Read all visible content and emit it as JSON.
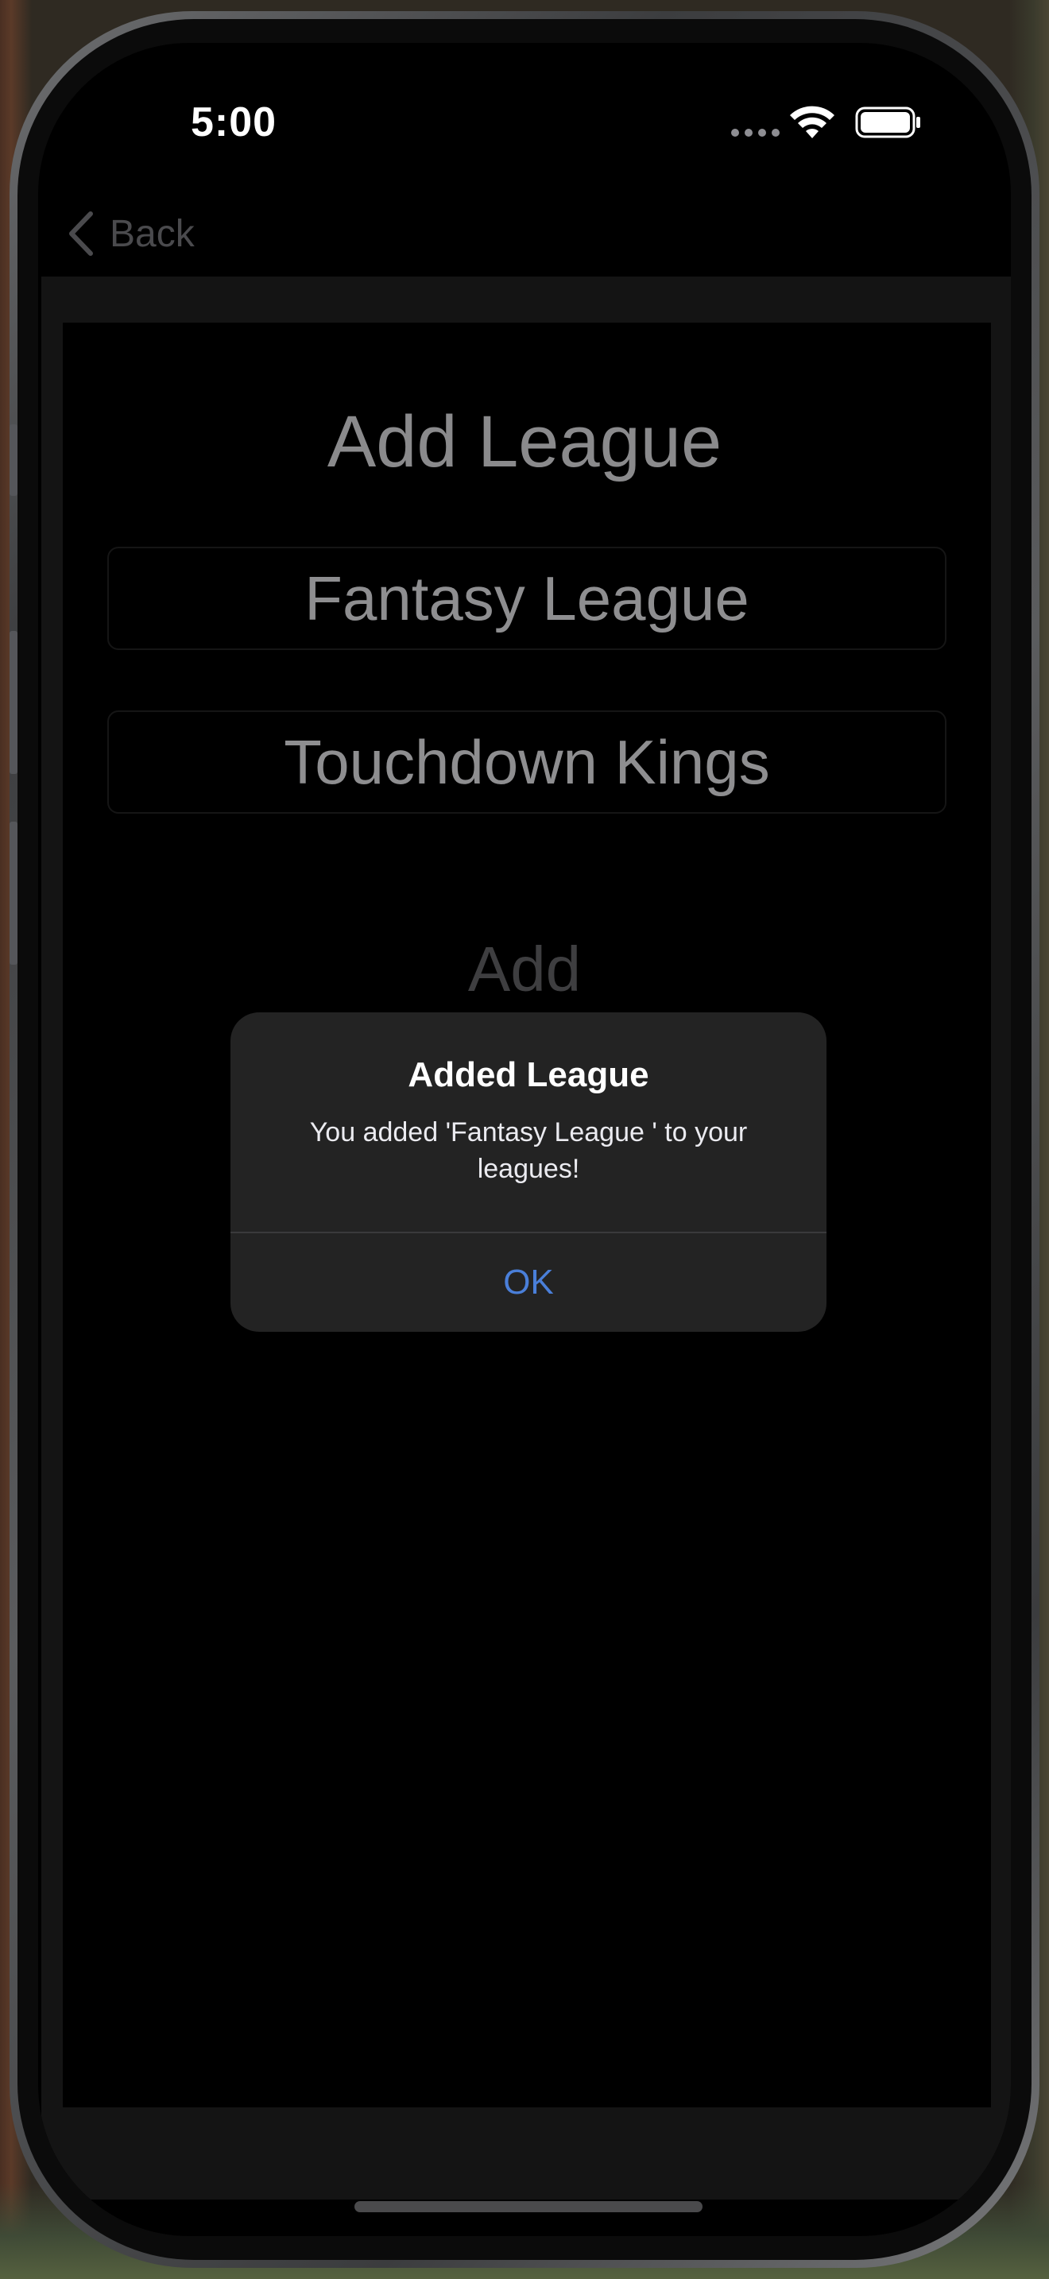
{
  "status_bar": {
    "time": "5:00"
  },
  "nav": {
    "back_label": "Back"
  },
  "page": {
    "title": "Add League",
    "fields": [
      {
        "value": "Fantasy League"
      },
      {
        "value": "Touchdown Kings"
      }
    ],
    "add_label": "Add"
  },
  "alert": {
    "title": "Added League",
    "message": "You added 'Fantasy League ' to your leagues!",
    "ok_label": "OK"
  },
  "colors": {
    "accent": "#4a7fd9",
    "alert_bg": "#232323",
    "screen_bg": "#000000"
  }
}
